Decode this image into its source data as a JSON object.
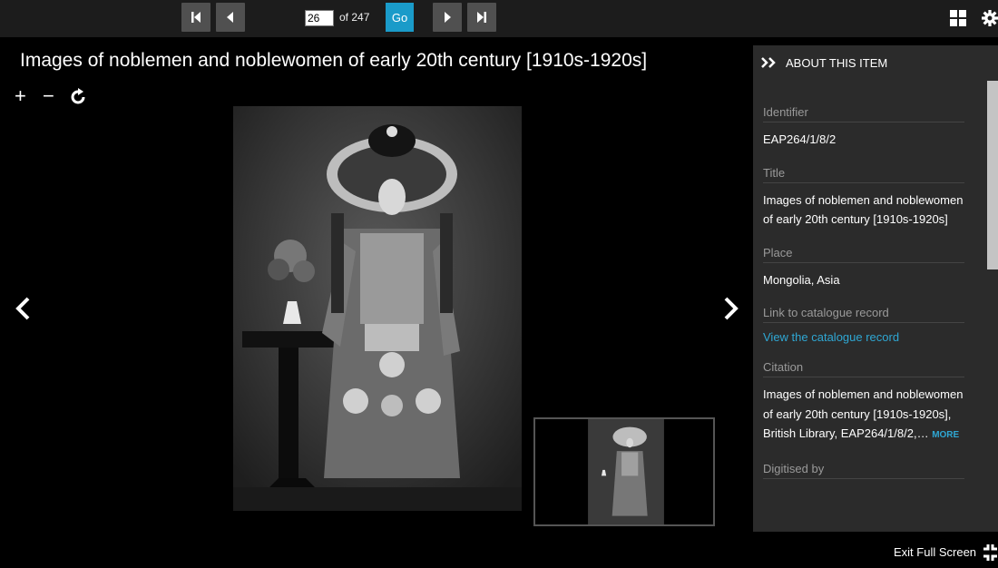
{
  "toolbar": {
    "first_page_icon": "first-page-icon",
    "prev_page_icon": "previous-page-icon",
    "current_page": "26",
    "page_count_text": "of 247",
    "go_label": "Go",
    "next_page_icon": "next-page-icon",
    "last_page_icon": "last-page-icon",
    "grid_icon": "grid-view-icon",
    "settings_icon": "gear-icon",
    "accent_color": "#1a9bc9"
  },
  "viewer": {
    "title": "Images of noblemen and noblewomen of early 20th century [1910s-1920s]",
    "zoom_in": "+",
    "zoom_out": "−",
    "rotate_icon": "rotate-icon",
    "prev_icon": "chevron-left-icon",
    "next_icon": "chevron-right-icon"
  },
  "sidebar": {
    "header": "ABOUT THIS ITEM",
    "fields": [
      {
        "label": "Identifier",
        "value": "EAP264/1/8/2"
      },
      {
        "label": "Title",
        "value": "Images of noblemen and noblewomen of early 20th century [1910s-1920s]"
      },
      {
        "label": "Place",
        "value": "Mongolia, Asia"
      },
      {
        "label": "Link to catalogue record",
        "link": "View the catalogue record"
      },
      {
        "label": "Citation",
        "value": "Images of noblemen and noblewomen of early 20th century [1910s-1920s], British Library, EAP264/1/8/2,…",
        "more": "MORE"
      },
      {
        "label": "Digitised by"
      }
    ],
    "link_color": "#2fa7d3"
  },
  "footer": {
    "exit_fullscreen": "Exit Full Screen"
  }
}
